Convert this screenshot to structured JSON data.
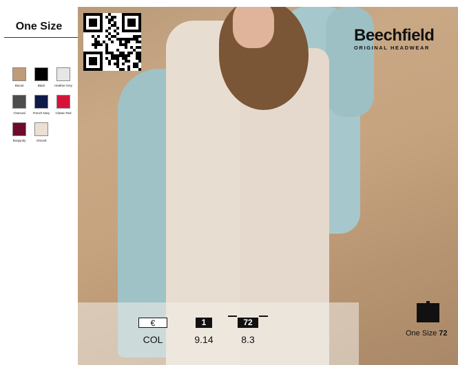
{
  "size": {
    "title": "One Size"
  },
  "swatches": [
    {
      "label": "Biscuit",
      "color": "#c19a78"
    },
    {
      "label": "Black",
      "color": "#000000"
    },
    {
      "label": "Heather Grey",
      "color": "#e6e6e6"
    },
    {
      "label": "Charcoal",
      "color": "#4d4d4d"
    },
    {
      "label": "French Navy",
      "color": "#0e1a48"
    },
    {
      "label": "Classic Red",
      "color": "#d8133a"
    },
    {
      "label": "Burgundy",
      "color": "#6e0a2d"
    },
    {
      "label": "Almond",
      "color": "#ece0d2"
    }
  ],
  "brand": {
    "name": "Beechfield",
    "tagline": "ORIGINAL HEADWEAR"
  },
  "pricing": {
    "currency_symbol": "€",
    "qty_label": "1",
    "carton_label": "72",
    "col_label": "COL",
    "price_single": "9.14",
    "price_carton": "8.3"
  },
  "carton": {
    "label": "One Size",
    "qty": "72"
  }
}
